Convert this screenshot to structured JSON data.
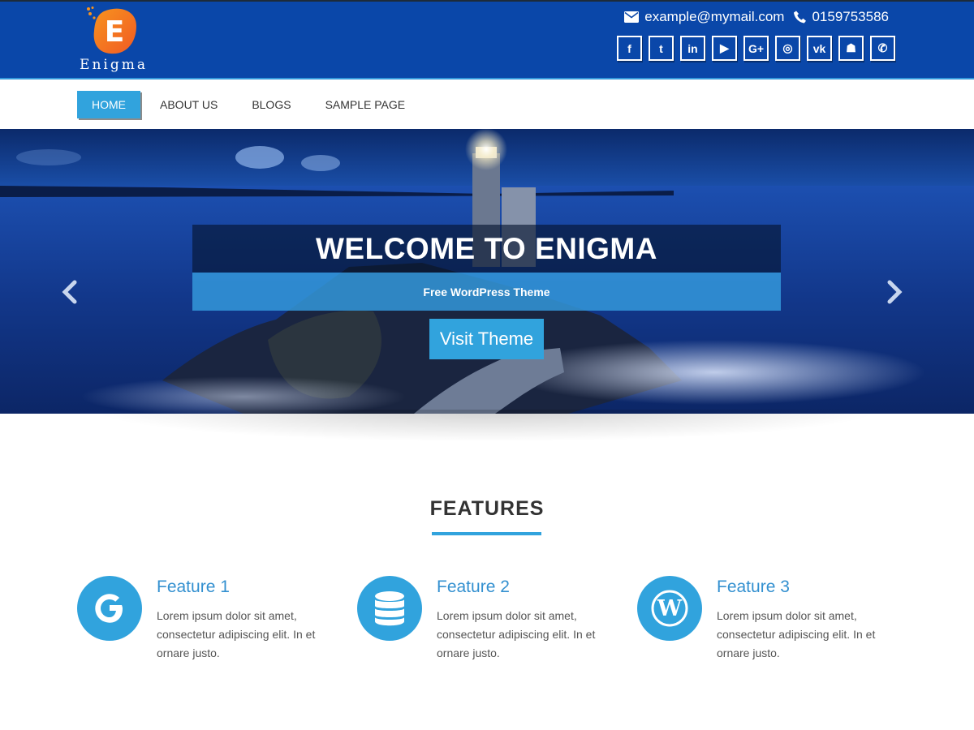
{
  "brand": {
    "logo_letter": "E",
    "name": "Enigma"
  },
  "contact": {
    "email": "example@mymail.com",
    "phone": "0159753586",
    "email_icon": "envelope-icon",
    "phone_icon": "phone-icon"
  },
  "socials": [
    {
      "icon": "facebook-icon",
      "glyph": "f"
    },
    {
      "icon": "twitter-icon",
      "glyph": "t"
    },
    {
      "icon": "linkedin-icon",
      "glyph": "in"
    },
    {
      "icon": "youtube-icon",
      "glyph": "▶"
    },
    {
      "icon": "google-plus-icon",
      "glyph": "G+"
    },
    {
      "icon": "instagram-icon",
      "glyph": "◎"
    },
    {
      "icon": "vk-icon",
      "glyph": "vk"
    },
    {
      "icon": "snapchat-icon",
      "glyph": "☗"
    },
    {
      "icon": "whatsapp-icon",
      "glyph": "✆"
    }
  ],
  "nav": {
    "items": [
      "HOME",
      "ABOUT US",
      "BLOGS",
      "SAMPLE PAGE"
    ],
    "active": "HOME"
  },
  "hero": {
    "title": "WELCOME TO ENIGMA",
    "subtitle": "Free WordPress Theme",
    "button": "Visit Theme",
    "prev_icon": "chevron-left-icon",
    "next_icon": "chevron-right-icon"
  },
  "features": {
    "heading": "FEATURES",
    "items": [
      {
        "title": "Feature 1",
        "text": "Lorem ipsum dolor sit amet, consectetur adipiscing elit. In et ornare justo.",
        "icon": "google-icon"
      },
      {
        "title": "Feature 2",
        "text": "Lorem ipsum dolor sit amet, consectetur adipiscing elit. In et ornare justo.",
        "icon": "database-icon"
      },
      {
        "title": "Feature 3",
        "text": "Lorem ipsum dolor sit amet, consectetur adipiscing elit. In et ornare justo.",
        "icon": "wordpress-icon"
      }
    ]
  },
  "colors": {
    "header_bg": "#0a47a9",
    "accent": "#31a3dd",
    "feature_title": "#3390d0"
  }
}
